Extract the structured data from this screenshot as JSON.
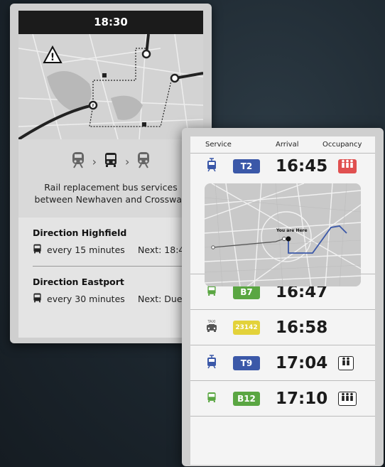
{
  "back": {
    "time": "18:30",
    "notice_line1": "Rail replacement bus services",
    "notice_line2": "between Newhaven and Crossway",
    "directions": [
      {
        "title": "Direction Highfield",
        "frequency": "every 15 minutes",
        "next": "Next: 18:4"
      },
      {
        "title": "Direction Eastport",
        "frequency": "every 30 minutes",
        "next": "Next: Due"
      }
    ]
  },
  "front": {
    "headers": {
      "service": "Service",
      "arrival": "Arrival",
      "occupancy": "Occupancy"
    },
    "map_label": "You are Here",
    "services": [
      {
        "icon": "tram-icon",
        "code": "T2",
        "time": "16:45",
        "badge_color": "#3b58a8",
        "icon_color": "#3b58a8",
        "occupancy": "full"
      },
      {
        "icon": "bus-icon",
        "code": "B7",
        "time": "16:47",
        "badge_color": "#5aa642",
        "icon_color": "#5aa642",
        "occupancy": "none"
      },
      {
        "icon": "taxi-icon",
        "code": "23142",
        "time": "16:58",
        "badge_color": "#e3d23a",
        "icon_color": "#555555",
        "occupancy": "none",
        "taxi_label": "TAXI"
      },
      {
        "icon": "tram-icon",
        "code": "T9",
        "time": "17:04",
        "badge_color": "#3b58a8",
        "icon_color": "#3b58a8",
        "occupancy": "medium"
      },
      {
        "icon": "bus-icon",
        "code": "B12",
        "time": "17:10",
        "badge_color": "#5aa642",
        "icon_color": "#5aa642",
        "occupancy": "high"
      }
    ]
  }
}
